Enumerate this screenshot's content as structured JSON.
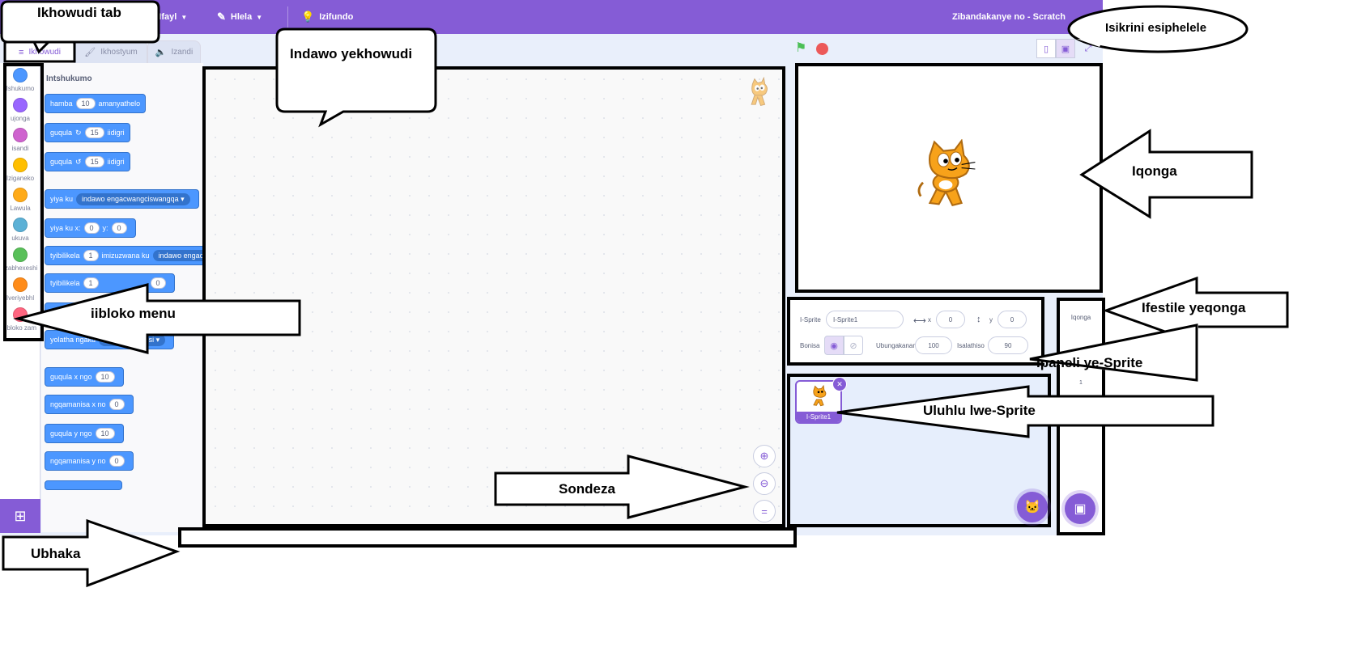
{
  "menubar": {
    "file": "Ifayl",
    "edit": "Hlela",
    "tutorials": "Izifundo",
    "project_title": "Zibandakanye no - Scratch"
  },
  "tabs": [
    {
      "label": "Ikhowudi"
    },
    {
      "label": "Ikhostyum"
    },
    {
      "label": "Izandi"
    }
  ],
  "categories": [
    {
      "label": "Ishukumo",
      "color": "#4c97ff"
    },
    {
      "label": "ujonga",
      "color": "#9966ff"
    },
    {
      "label": "isandi",
      "color": "#cf63cf"
    },
    {
      "label": "Iziganeko",
      "color": "#ffbf00"
    },
    {
      "label": "Lawula",
      "color": "#ffab19"
    },
    {
      "label": "ukuva",
      "color": "#5cb1d6"
    },
    {
      "label": "Izabhexeshi",
      "color": "#59c059"
    },
    {
      "label": "Iveriyebhl",
      "color": "#ff8c1a"
    },
    {
      "label": "iibloko zam",
      "color": "#ff6680"
    }
  ],
  "palette": {
    "heading": "Intshukumo",
    "blocks": [
      {
        "pre": "hamba",
        "slot": "10",
        "post": "amanyathelo"
      },
      {
        "pre": "guqula",
        "icon": "↻",
        "slot": "15",
        "post": "iidigri"
      },
      {
        "pre": "guqula",
        "icon": "↺",
        "slot": "15",
        "post": "iidigri"
      },
      {
        "pre": "yiya ku",
        "dropdown": "indawo engacwangciswangqa"
      },
      {
        "pre": "yiya ku x:",
        "slot": "0",
        "mid": "y:",
        "slot2": "0"
      },
      {
        "pre": "tyibilikela",
        "slot": "1",
        "post": "imizuzwana ku",
        "dropdown": "indawo engac"
      },
      {
        "pre": "tyibilikela",
        "slot": "1",
        "post": "",
        "slot2": "0"
      },
      {
        "pre": "yolatha kw"
      },
      {
        "pre": "yolatha ngaku",
        "dropdown": "impuku salithisi"
      },
      {
        "pre": "guqula x ngo",
        "slot": "10"
      },
      {
        "pre": "ngqamanisa x no",
        "slot": "0"
      },
      {
        "pre": "guqula y ngo",
        "slot": "10"
      },
      {
        "pre": "ngqamanisa y no",
        "slot": "0"
      }
    ]
  },
  "sprite_info": {
    "sprite_label": "I-Sprite",
    "sprite_name": "I-Sprite1",
    "x_label": "x",
    "x_value": "0",
    "y_label": "y",
    "y_value": "0",
    "show_label": "Bonisa",
    "size_label": "Ubungakanani",
    "size_value": "100",
    "direction_label": "Isalathiso",
    "direction_value": "90"
  },
  "sprite_list": {
    "sprites": [
      {
        "name": "I-Sprite1"
      }
    ]
  },
  "stage_target": {
    "label": "Iqonga",
    "backdrop_count": "1"
  },
  "annotations": {
    "code_tab": "Ikhowudi tab",
    "fullscreen": "Isikrini esiphelele",
    "code_area": "Indawo yekhowudi",
    "stage": "Iqonga",
    "block_menu": "iibloko menu",
    "stage_window": "Ifestile yeqonga",
    "sprite_panel": "Ipaneli ye-Sprite",
    "sprite_list": "Uluhlu lwe-Sprite",
    "zoom": "Sondeza",
    "scrollbar": "Ubhaka"
  },
  "colors": {
    "accent": "#855cd6",
    "motion": "#4c97ff",
    "flag": "#4cbf56",
    "stop": "#ec5959"
  }
}
